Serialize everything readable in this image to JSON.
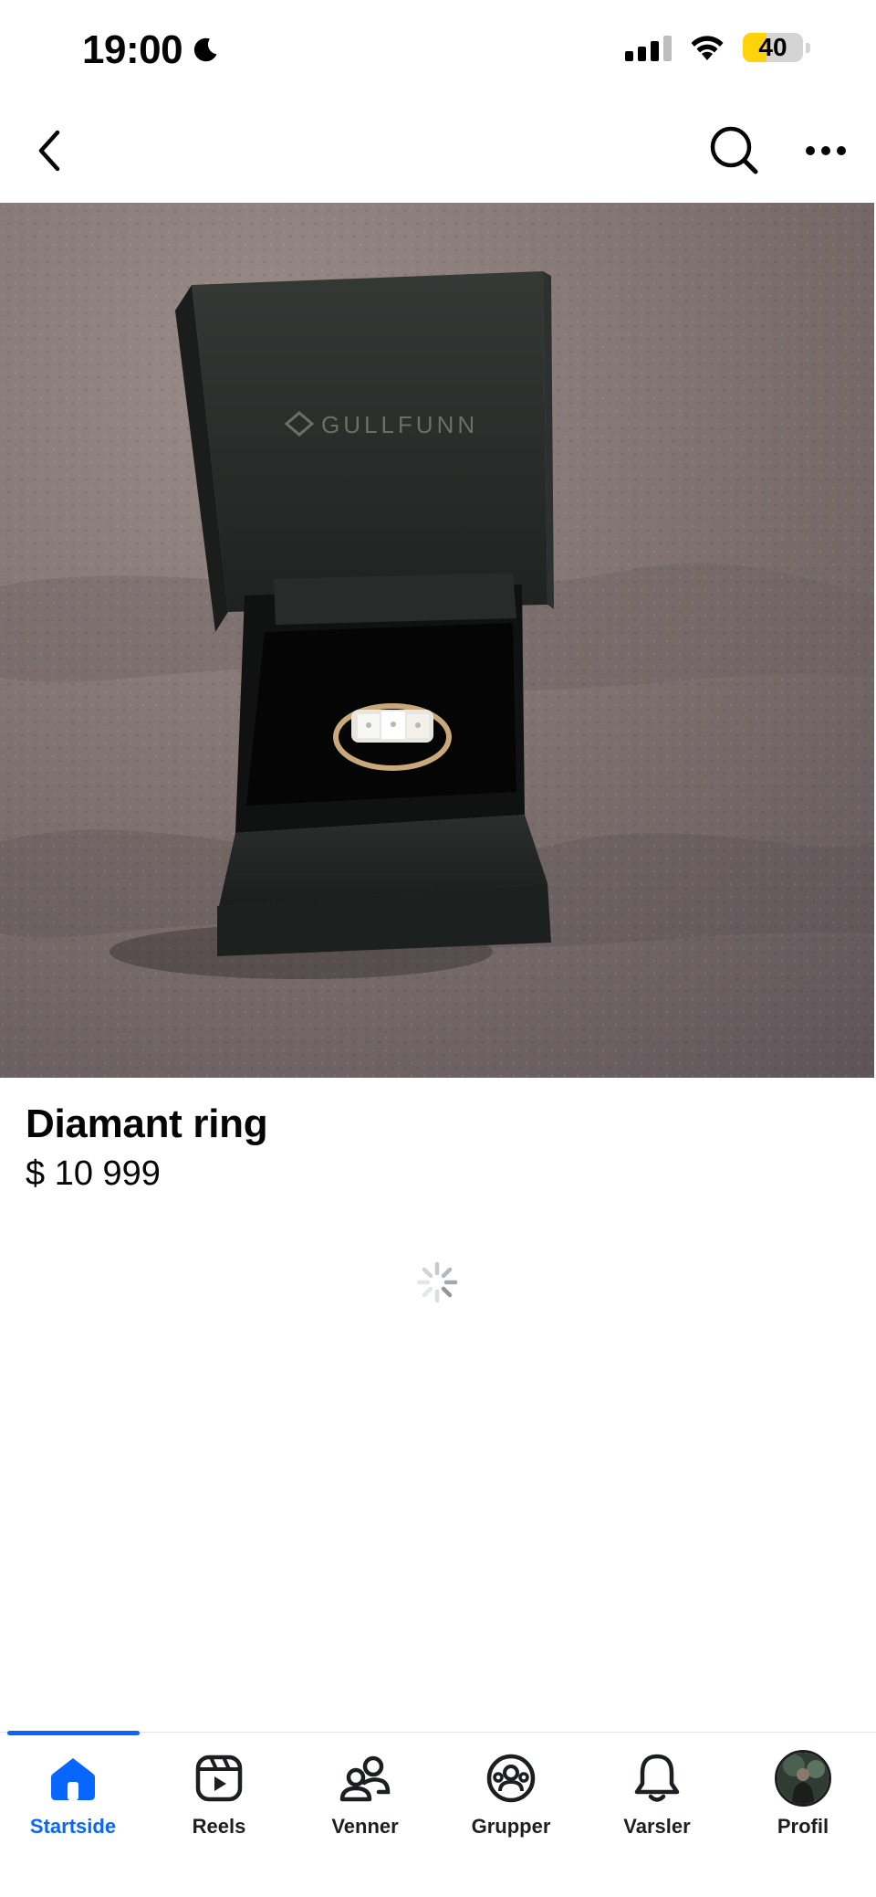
{
  "status_bar": {
    "time": "19:00",
    "battery_level": "40",
    "battery_fraction": 0.4,
    "icons": [
      "moon-icon",
      "cellular-signal-icon",
      "wifi-icon",
      "battery-icon"
    ]
  },
  "nav": {
    "icons": [
      "back-chevron-icon",
      "search-icon",
      "more-options-icon"
    ]
  },
  "photo": {
    "box_brand": "GULLFUNN",
    "subject": "diamond ring in open jewelry box on carpet"
  },
  "listing": {
    "title": "Diamant ring",
    "price": "$ 10 999"
  },
  "tab_bar": {
    "active_color": "#0866ff",
    "tabs": [
      {
        "label": "Startside",
        "icon": "home-icon",
        "active": true
      },
      {
        "label": "Reels",
        "icon": "reels-icon",
        "active": false
      },
      {
        "label": "Venner",
        "icon": "friends-icon",
        "active": false
      },
      {
        "label": "Grupper",
        "icon": "groups-icon",
        "active": false
      },
      {
        "label": "Varsler",
        "icon": "bell-icon",
        "active": false
      },
      {
        "label": "Profil",
        "icon": "avatar",
        "active": false
      }
    ]
  }
}
